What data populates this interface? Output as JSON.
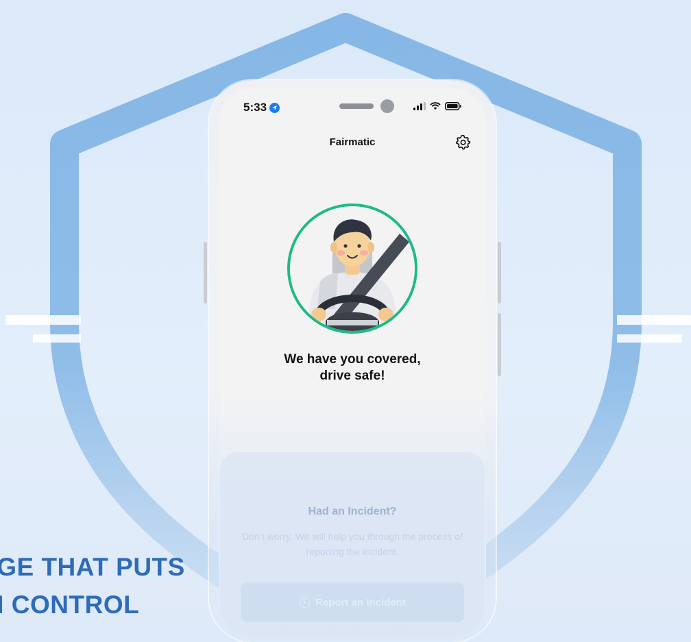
{
  "status_bar": {
    "time": "5:33"
  },
  "app": {
    "title": "Fairmatic"
  },
  "main": {
    "headline_line1": "We have you covered,",
    "headline_line2": "drive safe!"
  },
  "incident_card": {
    "title": "Had an Incident?",
    "text": "Don’t worry. We will help you through the process of reporting the incident.",
    "button_label": "Report an Incident"
  },
  "tagline": {
    "line1": "AGE THAT PUTS",
    "line2": "IN CONTROL"
  },
  "colors": {
    "shield": "#86b7e6",
    "accent_green": "#1fba87",
    "tagline": "#2e6bb8",
    "location_blue": "#1a7cf2"
  },
  "icons": {
    "location": "location-arrow-icon",
    "signal": "cellular-signal-icon",
    "wifi": "wifi-icon",
    "battery": "battery-icon",
    "settings": "gear-icon",
    "info": "info-icon"
  }
}
